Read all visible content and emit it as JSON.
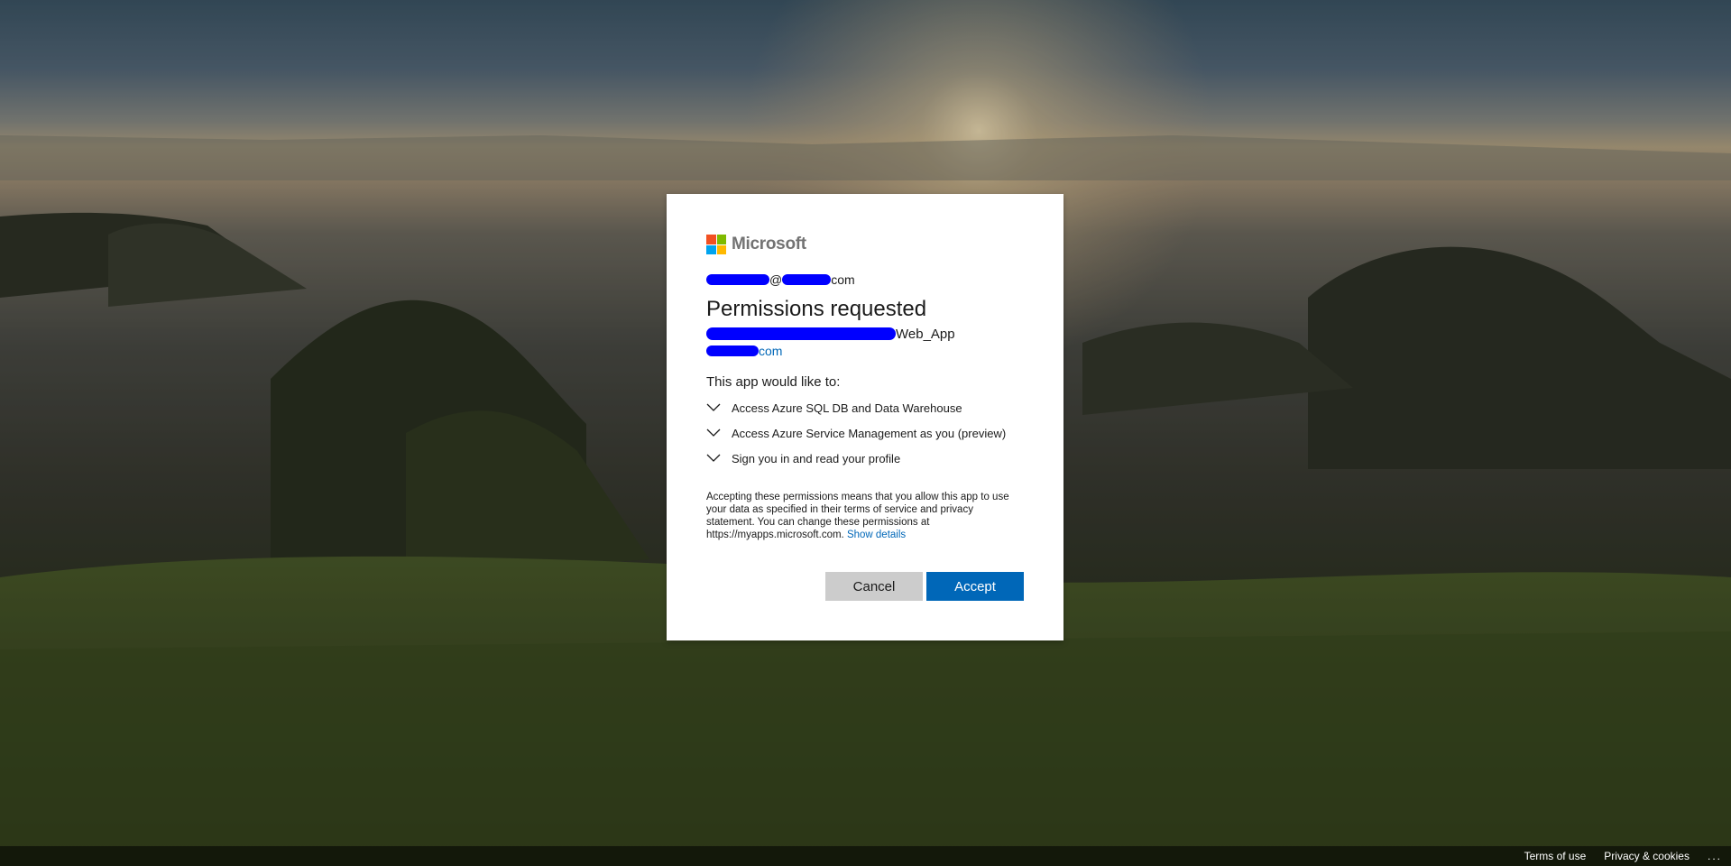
{
  "brand": {
    "name": "Microsoft"
  },
  "account": {
    "email_suffix": "com",
    "at": "@"
  },
  "dialog": {
    "title": "Permissions requested",
    "app_suffix": "Web_App",
    "domain_suffix": "com",
    "intro": "This app would like to:",
    "permissions": [
      "Access Azure SQL DB and Data Warehouse",
      "Access Azure Service Management as you (preview)",
      "Sign you in and read your profile"
    ],
    "legal_text": "Accepting these permissions means that you allow this app to use your data as specified in their terms of service and privacy statement. You can change these permissions at https://myapps.microsoft.com.",
    "show_details": "Show details",
    "cancel_label": "Cancel",
    "accept_label": "Accept"
  },
  "footer": {
    "terms": "Terms of use",
    "privacy": "Privacy & cookies",
    "more": "..."
  },
  "colors": {
    "accent": "#0067b8",
    "redaction": "#0000ff",
    "cancel_bg": "#cccccc"
  }
}
